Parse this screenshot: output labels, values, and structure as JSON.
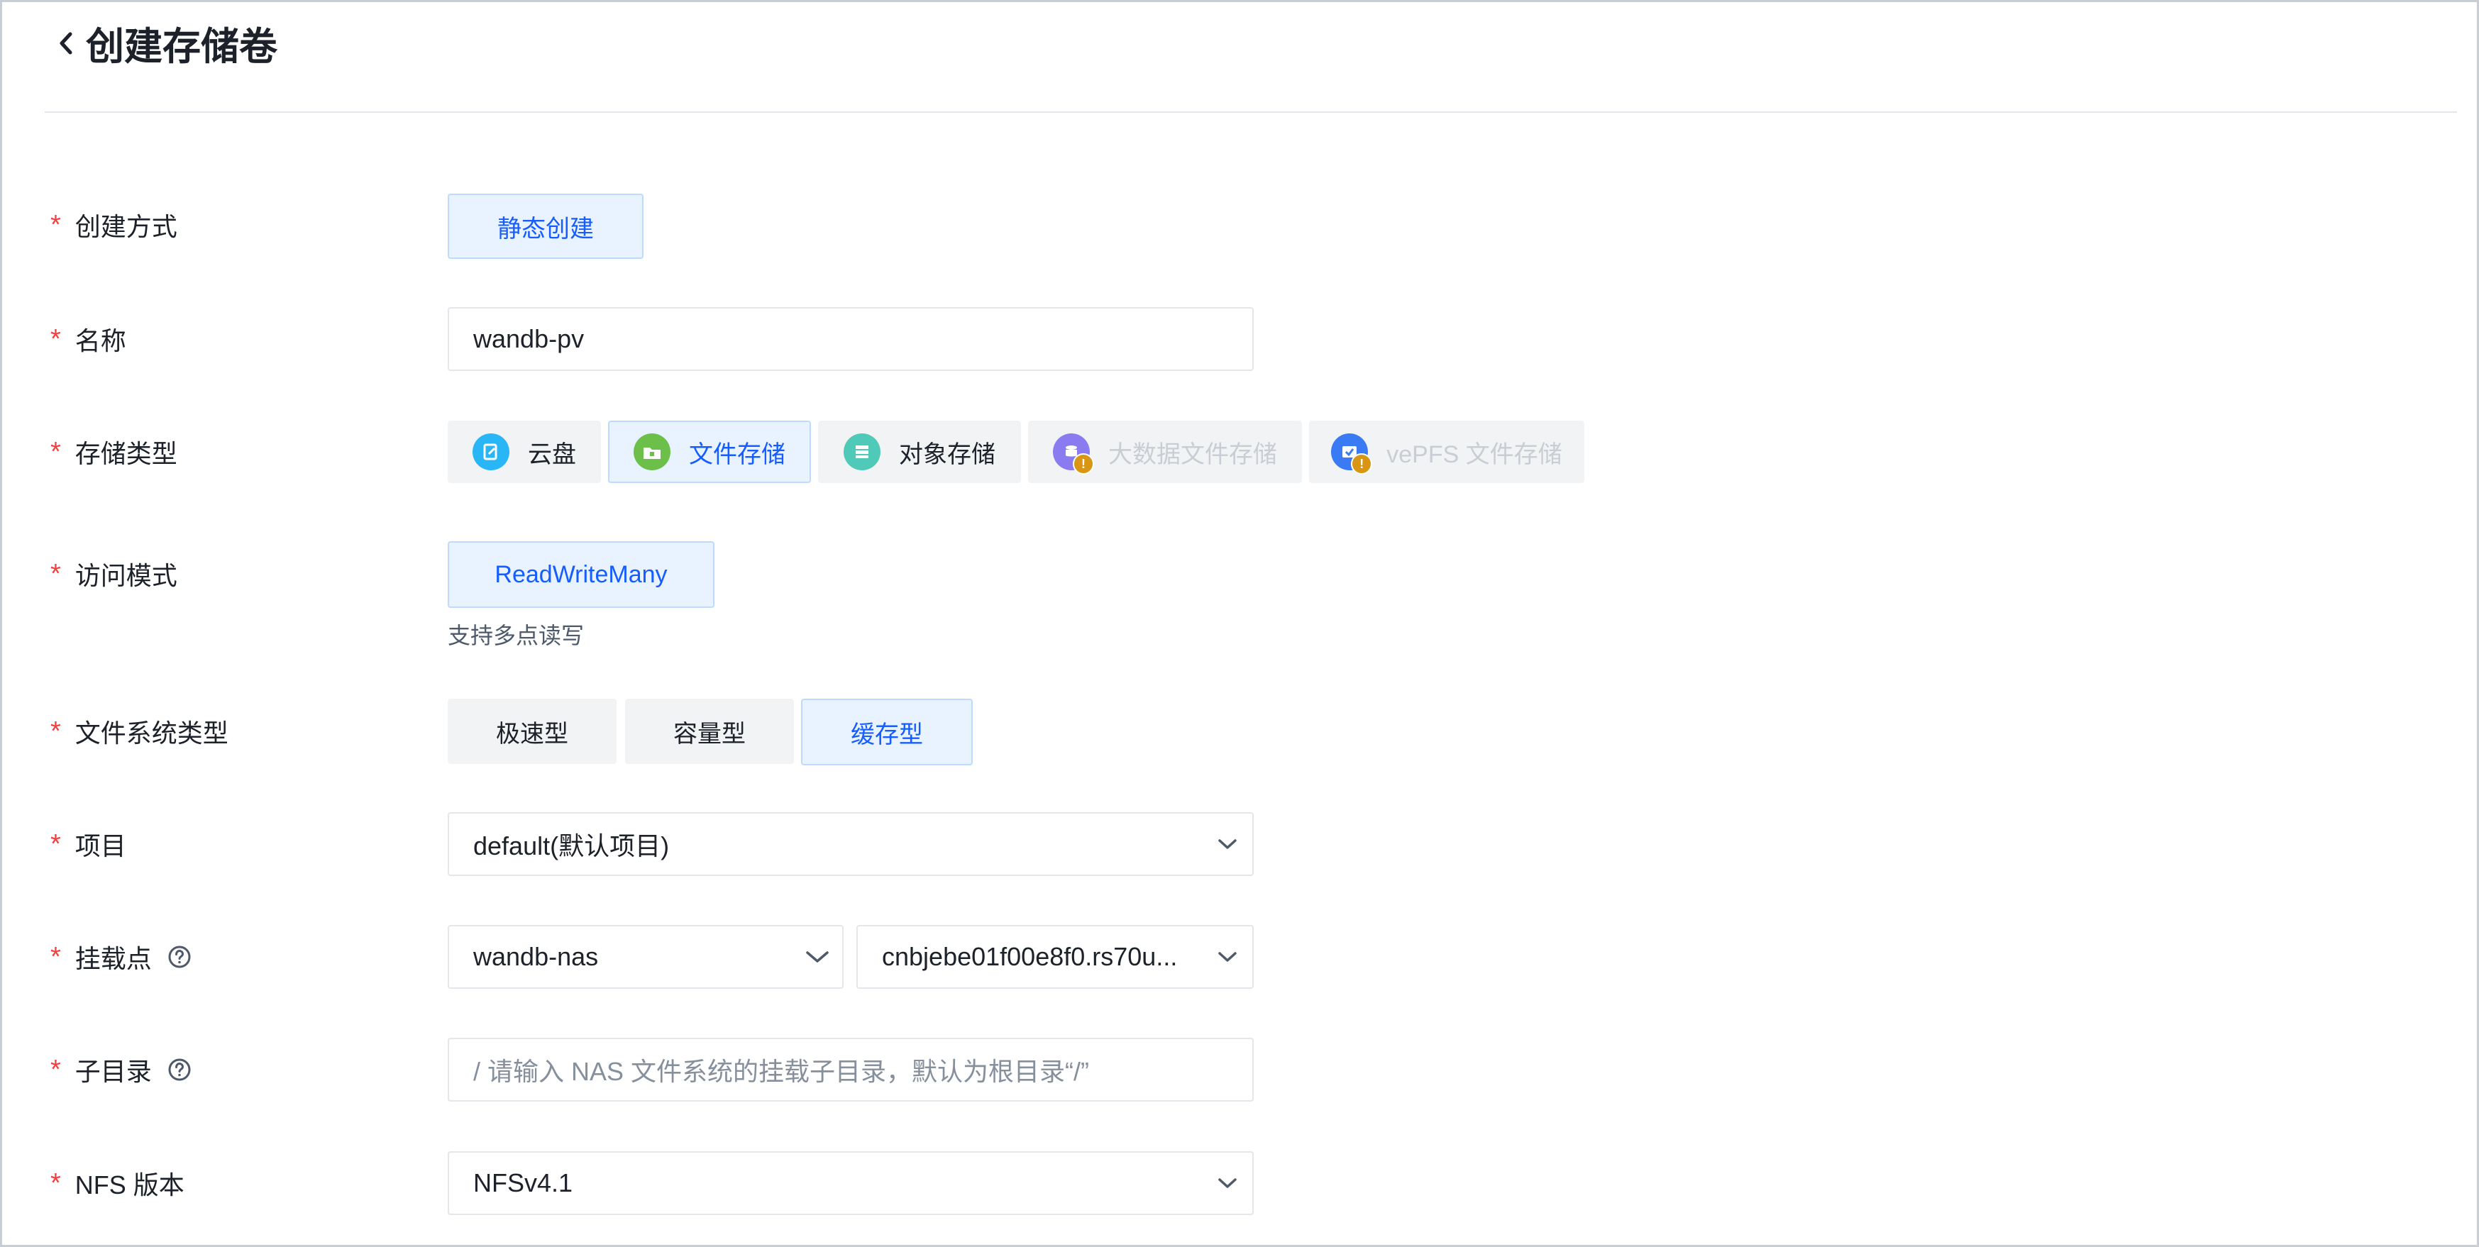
{
  "page": {
    "title": "创建存储卷"
  },
  "form": {
    "create_method": {
      "label": "创建方式",
      "option": "静态创建"
    },
    "name": {
      "label": "名称",
      "value": "wandb-pv"
    },
    "storage_type": {
      "label": "存储类型",
      "options": [
        {
          "label": "云盘",
          "icon": "cloud-disk-icon",
          "color": "#29b6f6",
          "state": "normal"
        },
        {
          "label": "文件存储",
          "icon": "file-storage-icon",
          "color": "#6cc04a",
          "state": "selected"
        },
        {
          "label": "对象存储",
          "icon": "object-storage-icon",
          "color": "#4fc9b8",
          "state": "normal"
        },
        {
          "label": "大数据文件存储",
          "icon": "big-data-file-storage-icon",
          "color": "#8a7cf0",
          "state": "disabled"
        },
        {
          "label": "vePFS 文件存储",
          "icon": "vepfs-storage-icon",
          "color": "#3a7bf5",
          "state": "disabled"
        }
      ]
    },
    "access_mode": {
      "label": "访问模式",
      "option": "ReadWriteMany",
      "hint": "支持多点读写"
    },
    "fs_type": {
      "label": "文件系统类型",
      "options": [
        {
          "label": "极速型",
          "state": "normal"
        },
        {
          "label": "容量型",
          "state": "normal"
        },
        {
          "label": "缓存型",
          "state": "selected"
        }
      ]
    },
    "project": {
      "label": "项目",
      "value": "default(默认项目)"
    },
    "mount_point": {
      "label": "挂载点",
      "nas_value": "wandb-nas",
      "mount_value": "cnbjebe01f00e8f0.rs70u..."
    },
    "sub_dir": {
      "label": "子目录",
      "placeholder": "/ 请输入 NAS 文件系统的挂载子目录，默认为根目录“/”"
    },
    "nfs_version": {
      "label": "NFS 版本",
      "value": "NFSv4.1"
    }
  },
  "colors": {
    "accent": "#165dff",
    "required": "#f53f3f",
    "selected_bg": "#e8f3ff",
    "warning_badge": "#d89614"
  }
}
